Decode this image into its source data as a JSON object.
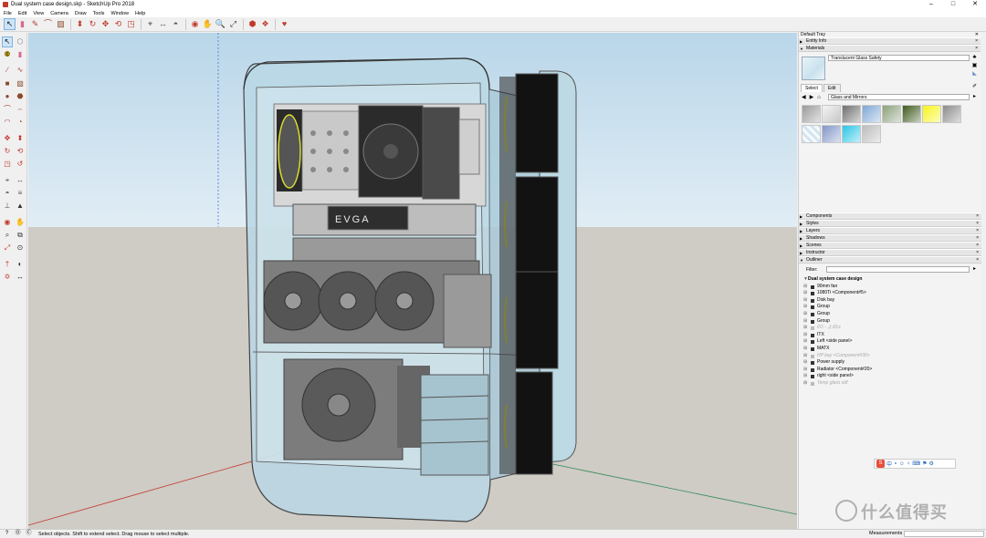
{
  "window": {
    "title": "Dual system case design.skp - SketchUp Pro 2018",
    "controls": [
      "–",
      "□",
      "✕"
    ]
  },
  "menu": [
    "File",
    "Edit",
    "View",
    "Camera",
    "Draw",
    "Tools",
    "Window",
    "Help"
  ],
  "toolbar_icons": [
    "select-icon",
    "eraser-icon",
    "paint-bucket-icon",
    "pencil-line-icon",
    "arc-icon",
    "rectangle-icon",
    "push-pull-icon",
    "follow-me-icon",
    "move-icon",
    "rotate-icon",
    "scale-icon",
    "offset-icon",
    "tape-measure-icon",
    "dimension-icon",
    "protractor-icon",
    "text-icon",
    "axes-icon",
    "3d-text-icon",
    "orbit-icon",
    "pan-icon",
    "zoom-icon",
    "zoom-extents-icon",
    "component-icon",
    "group-icon",
    "warehouse-icon",
    "extension-icon"
  ],
  "status": {
    "hint": "Select objects. Shift to extend select. Drag mouse to select multiple.",
    "measurements_label": "Measurements"
  },
  "tray": {
    "title": "Default Tray",
    "entity_info": "Entity Info",
    "materials": "Materials",
    "material_name": "Translucent Glass Safety",
    "tab_select": "Select",
    "tab_edit": "Edit",
    "library": "Glass and Mirrors",
    "swatch_colors": [
      "#9a9a9a",
      "#d7d7d7",
      "#6f6f6f",
      "#7fa7d6",
      "#8aa07a",
      "#3d5a1c",
      "#f6f51a",
      "#8b8b8b",
      "#d4e5f0",
      "#8296c8",
      "#2bc6e6",
      "#bcbcbc"
    ],
    "panels": [
      "Components",
      "Styles",
      "Layers",
      "Shadows",
      "Scenes",
      "Instructor",
      "Outliner"
    ],
    "filter_label": "Filter:"
  },
  "outliner": {
    "root": "Dual system case design",
    "items": [
      {
        "label": "90mm fan",
        "hidden": false
      },
      {
        "label": "1080Ti <Component#5>",
        "hidden": false
      },
      {
        "label": "Disk bay",
        "hidden": false
      },
      {
        "label": "Group",
        "hidden": false
      },
      {
        "label": "Group",
        "hidden": false
      },
      {
        "label": "Group",
        "hidden": false
      },
      {
        "label": "I/O - 上式cc",
        "hidden": true
      },
      {
        "label": "ITX",
        "hidden": false
      },
      {
        "label": "Left <side panel>",
        "hidden": false
      },
      {
        "label": "MATX",
        "hidden": false
      },
      {
        "label": "HP bay <Component#30>",
        "hidden": true
      },
      {
        "label": "Power supply",
        "hidden": false
      },
      {
        "label": "Radiator <Component#20>",
        "hidden": false
      },
      {
        "label": "right <side panel>",
        "hidden": false
      },
      {
        "label": "Temp glass sdf",
        "hidden": true
      }
    ]
  },
  "viewport_text": {
    "gpu_brand": "EVGA"
  },
  "watermark": "什么值得买"
}
